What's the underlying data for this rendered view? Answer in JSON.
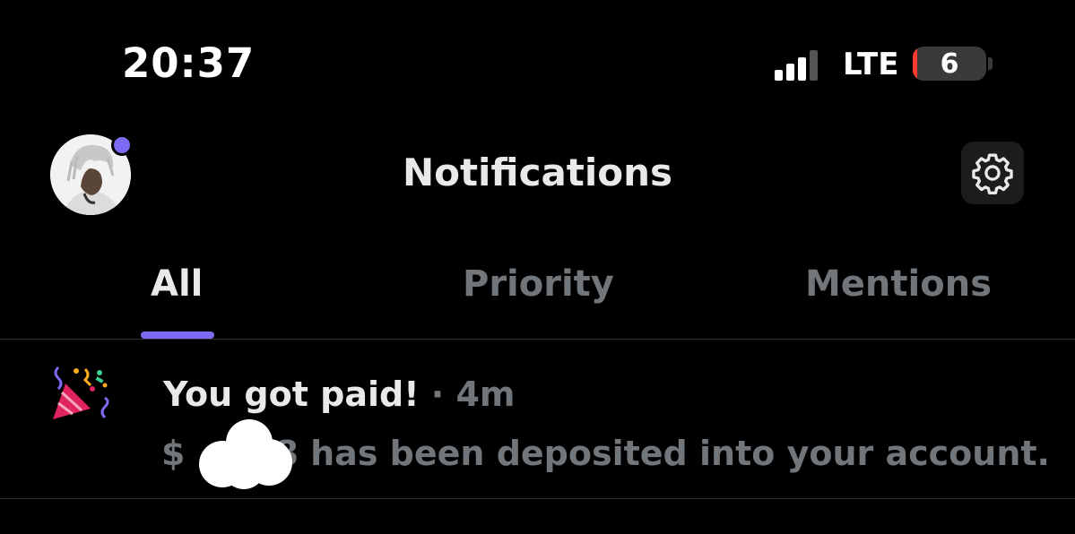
{
  "status_bar": {
    "time": "20:37",
    "network": "LTE",
    "battery_level": "6",
    "signal_bars_active": 3,
    "signal_bars_total": 4
  },
  "header": {
    "title": "Notifications",
    "avatar_icon": "avatar",
    "settings_icon": "gear-icon"
  },
  "tabs": [
    {
      "label": "All",
      "active": true
    },
    {
      "label": "Priority",
      "active": false
    },
    {
      "label": "Mentions",
      "active": false
    }
  ],
  "notification": {
    "icon": "party-popper-icon",
    "title": "You got paid!",
    "separator": "·",
    "age": "4m",
    "body_prefix": "$",
    "body_suffix": "8 has been deposited into your account."
  },
  "colors": {
    "background": "#000000",
    "accent": "#7c6bf2",
    "text_primary": "#e7e9ea",
    "text_secondary": "#71767b",
    "battery_low": "#ff3b30"
  }
}
